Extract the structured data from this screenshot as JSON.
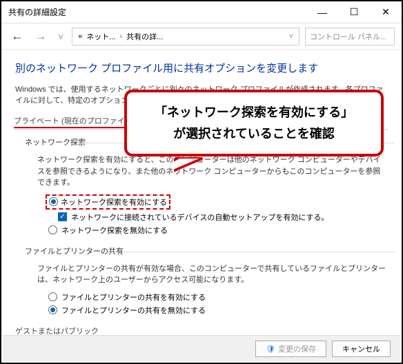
{
  "window": {
    "title": "共有の詳細設定"
  },
  "nav": {
    "crumb1": "ネット...",
    "crumb2": "共有の詳...",
    "search_placeholder": "コントロール パネル..."
  },
  "heading": "別のネットワーク プロファイル用に共有オプションを変更します",
  "subtext": "Windows では、使用するネットワークごとに別々のネットワーク プロファイルが作成されます。各プロファイルに対して、特定のオプションを選択できます。",
  "profile_label": "プライベート (現在のプロファイル)",
  "groups": {
    "discovery": {
      "title": "ネットワーク探索",
      "desc": "ネットワーク探索を有効にすると、このコンピューターは他のネットワーク コンピューターやデバイスを参照できるようになり、また他のネットワーク コンピューターからもこのコンピューターを参照できます。",
      "opt_on": "ネットワーク探索を有効にする",
      "opt_auto": "ネットワークに接続されているデバイスの自動セットアップを有効にする。",
      "opt_off": "ネットワーク探索を無効にする"
    },
    "printer": {
      "title": "ファイルとプリンターの共有",
      "desc": "ファイルとプリンターの共有が有効な場合、このコンピューターで共有しているファイルとプリンターは、ネットワーク上のユーザーからアクセス可能になります。",
      "opt_on": "ファイルとプリンターの共有を有効にする",
      "opt_off": "ファイルとプリンターの共有を無効にする"
    }
  },
  "guest_label": "ゲストまたはパブリック",
  "footer": {
    "save": "変更の保存",
    "cancel": "キャンセル"
  },
  "callout": {
    "line1": "「ネットワーク探索を有効にする」",
    "line2": "が選択されていることを確認"
  }
}
